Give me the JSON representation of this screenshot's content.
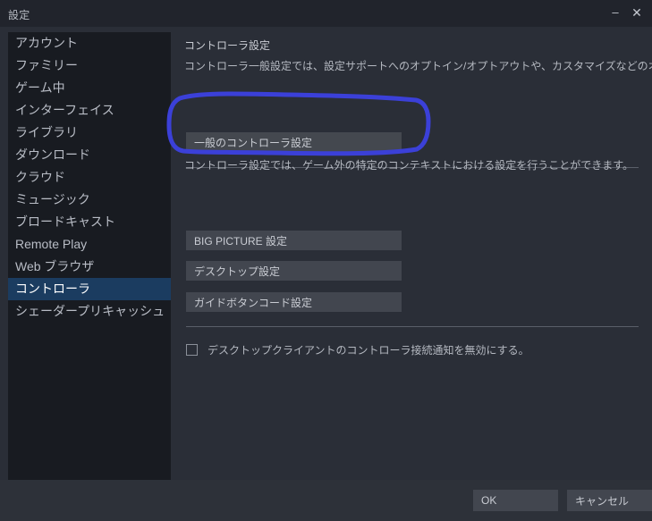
{
  "window": {
    "title": "設定",
    "minimize_label": "–",
    "close_label": "✕"
  },
  "sidebar": {
    "items": [
      {
        "label": "アカウント",
        "selected": false
      },
      {
        "label": "ファミリー",
        "selected": false
      },
      {
        "label": "ゲーム中",
        "selected": false
      },
      {
        "label": "インターフェイス",
        "selected": false
      },
      {
        "label": "ライブラリ",
        "selected": false
      },
      {
        "label": "ダウンロード",
        "selected": false
      },
      {
        "label": "クラウド",
        "selected": false
      },
      {
        "label": "ミュージック",
        "selected": false
      },
      {
        "label": "ブロードキャスト",
        "selected": false
      },
      {
        "label": "Remote Play",
        "selected": false
      },
      {
        "label": "Web ブラウザ",
        "selected": false
      },
      {
        "label": "コントローラ",
        "selected": true
      },
      {
        "label": "シェーダープリキャッシュ",
        "selected": false
      }
    ]
  },
  "main": {
    "content_title": "コントローラ設定",
    "description_1": "コントローラ一般設定では、設定サポートへのオプトイン/オプトアウトや、カスタマイズなどのオプションを設定できます。",
    "description_2": "コントローラ設定では、ゲーム外の特定のコンテキストにおける設定を行うことができます。",
    "buttons": {
      "general": "一般のコントローラ設定",
      "big_picture": "BIG PICTURE 設定",
      "desktop": "デスクトップ設定",
      "guide_button": "ガイドボタンコード設定"
    },
    "checkbox": {
      "label": "デスクトップクライアントのコントローラ接続通知を無効にする。",
      "checked": false
    }
  },
  "footer": {
    "ok_label": "OK",
    "cancel_label": "キャンセル"
  },
  "annotation": {
    "shape": "hand-drawn-rounded-rectangle",
    "color": "#3b40d8",
    "targets": "一般のコントローラ設定"
  },
  "colors": {
    "window_background": "#2a2e37",
    "titlebar_background": "#21242c",
    "sidebar_background": "#181b21",
    "selected_item_background": "#1b3c60",
    "button_background": "#42464f",
    "footer_background": "#2d3139",
    "text_primary": "#c9ccd3",
    "annotation_blue": "#3b40d8"
  }
}
